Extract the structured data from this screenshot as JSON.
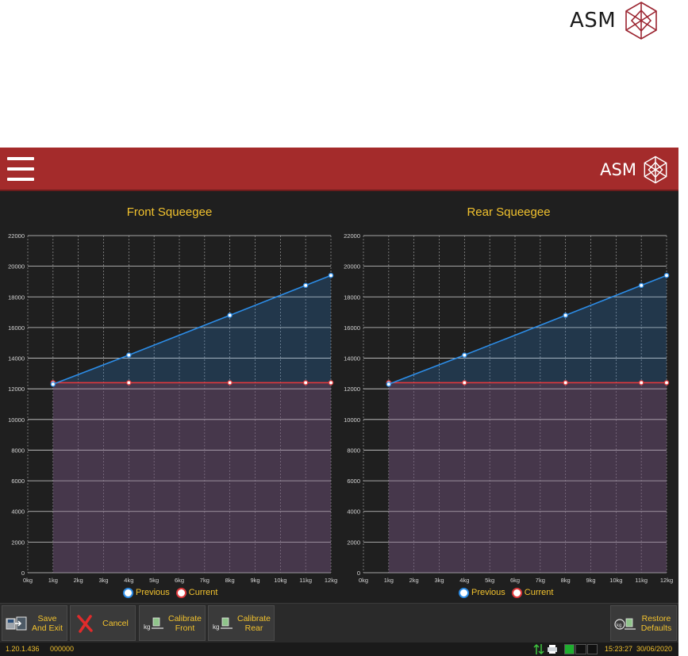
{
  "logo": {
    "text": "ASM"
  },
  "header": {
    "logo_text": "ASM"
  },
  "legend": {
    "previous": "Previous",
    "current": "Current"
  },
  "colors": {
    "header_red": "#a42b2b",
    "accent_yellow": "#f2c22e",
    "previous_blue": "#2c8ce6",
    "current_red": "#e0393c"
  },
  "charts": [
    {
      "title": "Front Squeegee",
      "x_ticks": [
        "0kg",
        "1kg",
        "2kg",
        "3kg",
        "4kg",
        "5kg",
        "6kg",
        "7kg",
        "8kg",
        "9kg",
        "10kg",
        "11kg",
        "12kg"
      ],
      "y_ticks": [
        "0",
        "2000",
        "4000",
        "6000",
        "8000",
        "10000",
        "12000",
        "14000",
        "16000",
        "18000",
        "20000",
        "22000"
      ]
    },
    {
      "title": "Rear Squeegee",
      "x_ticks": [
        "0kg",
        "1kg",
        "2kg",
        "3kg",
        "4kg",
        "5kg",
        "6kg",
        "7kg",
        "8kg",
        "9kg",
        "10kg",
        "11kg",
        "12kg"
      ],
      "y_ticks": [
        "0",
        "2000",
        "4000",
        "6000",
        "8000",
        "10000",
        "12000",
        "14000",
        "16000",
        "18000",
        "20000",
        "22000"
      ]
    }
  ],
  "chart_data": [
    {
      "type": "area",
      "title": "Front Squeegee",
      "xlim": [
        0,
        12
      ],
      "ylim": [
        0,
        22000
      ],
      "grid": true,
      "legend": "bottom",
      "series": [
        {
          "name": "Previous",
          "x": [
            1,
            4,
            8,
            11,
            12
          ],
          "values": [
            12300,
            14200,
            16800,
            18750,
            19400
          ]
        },
        {
          "name": "Current",
          "x": [
            1,
            4,
            8,
            11,
            12
          ],
          "values": [
            12400,
            12400,
            12400,
            12400,
            12400
          ]
        }
      ]
    },
    {
      "type": "area",
      "title": "Rear Squeegee",
      "xlim": [
        0,
        12
      ],
      "ylim": [
        0,
        22000
      ],
      "grid": true,
      "legend": "bottom",
      "series": [
        {
          "name": "Previous",
          "x": [
            1,
            4,
            8,
            11,
            12
          ],
          "values": [
            12300,
            14200,
            16800,
            18750,
            19400
          ]
        },
        {
          "name": "Current",
          "x": [
            1,
            4,
            8,
            11,
            12
          ],
          "values": [
            12400,
            12400,
            12400,
            12400,
            12400
          ]
        }
      ]
    }
  ],
  "toolbar": {
    "save_label": "Save And Exit",
    "cancel_label": "Cancel",
    "calibrate_front_label": "Calibrate Front",
    "calibrate_rear_label": "Calibrate Rear",
    "restore_label": "Restore Defaults",
    "kg_icon_text": "kg"
  },
  "status": {
    "version": "1.20.1.436",
    "code": "000000",
    "time": "15:23:27",
    "date": "30/06/2020"
  }
}
